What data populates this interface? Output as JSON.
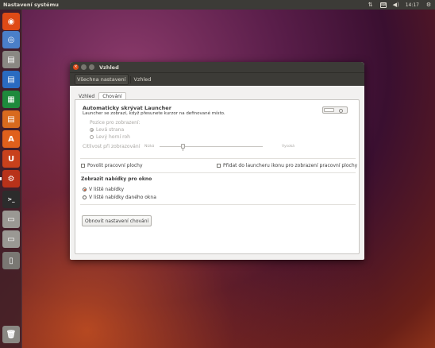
{
  "top_panel": {
    "title": "Nastavení systému",
    "clock": "14:17"
  },
  "launcher": {
    "items": [
      {
        "name": "dash-icon",
        "glyph": "◉",
        "color": "#df4a16"
      },
      {
        "name": "chromium-icon",
        "glyph": "◎",
        "color": "#4a7fc9"
      },
      {
        "name": "file-manager-icon",
        "glyph": "▤",
        "color": "#8a8883"
      },
      {
        "name": "writer-icon",
        "glyph": "▤",
        "color": "#2a6bc1"
      },
      {
        "name": "calc-icon",
        "glyph": "▦",
        "color": "#1e8a3c"
      },
      {
        "name": "impress-icon",
        "glyph": "▤",
        "color": "#d86a1e"
      },
      {
        "name": "software-center-icon",
        "glyph": "A",
        "color": "#e0601c"
      },
      {
        "name": "ubuntu-one-icon",
        "glyph": "U",
        "color": "#c8411c"
      },
      {
        "name": "system-settings-icon",
        "glyph": "⚙",
        "color": "#b8321a"
      },
      {
        "name": "terminal-icon",
        "glyph": ">_",
        "color": "#2c2c2c"
      },
      {
        "name": "drive-icon-1",
        "glyph": "▭",
        "color": "#9a9893"
      },
      {
        "name": "drive-icon-2",
        "glyph": "▭",
        "color": "#9a9893"
      },
      {
        "name": "drive-icon-3",
        "glyph": "▭",
        "color": "#9a9893"
      },
      {
        "name": "usb-icon",
        "glyph": "▯",
        "color": "#7a7873"
      },
      {
        "name": "trash-icon",
        "glyph": "🗑",
        "color": "#8a8883"
      }
    ]
  },
  "dialog": {
    "title": "Vzhled",
    "breadcrumbs": [
      "Všechna nastavení",
      "Vzhled"
    ],
    "tabs": [
      "Vzhled",
      "Chování"
    ],
    "autohide": {
      "heading": "Automaticky skrývat Launcher",
      "description": "Launcher se zobrazí, když přesunete kurzor na definované místo."
    },
    "reveal_location": {
      "label": "Pozice pro zobrazení:",
      "options": [
        "Levá strana",
        "Levý horní roh"
      ]
    },
    "sensitivity": {
      "label": "Citlivost při zobrazování",
      "low": "Nízká",
      "high": "Vysoká",
      "value": 0.25
    },
    "workspaces_label": "Povolit pracovní plochy",
    "show_desktop_label": "Přidat do launcheru ikonu pro zobrazení pracovní plochy",
    "menus": {
      "heading": "Zobrazit nabídky pro okno",
      "options": [
        "V liště nabídky",
        "V liště nabídky daného okna"
      ]
    },
    "reset_button": "Obnovit nastavení chování"
  }
}
